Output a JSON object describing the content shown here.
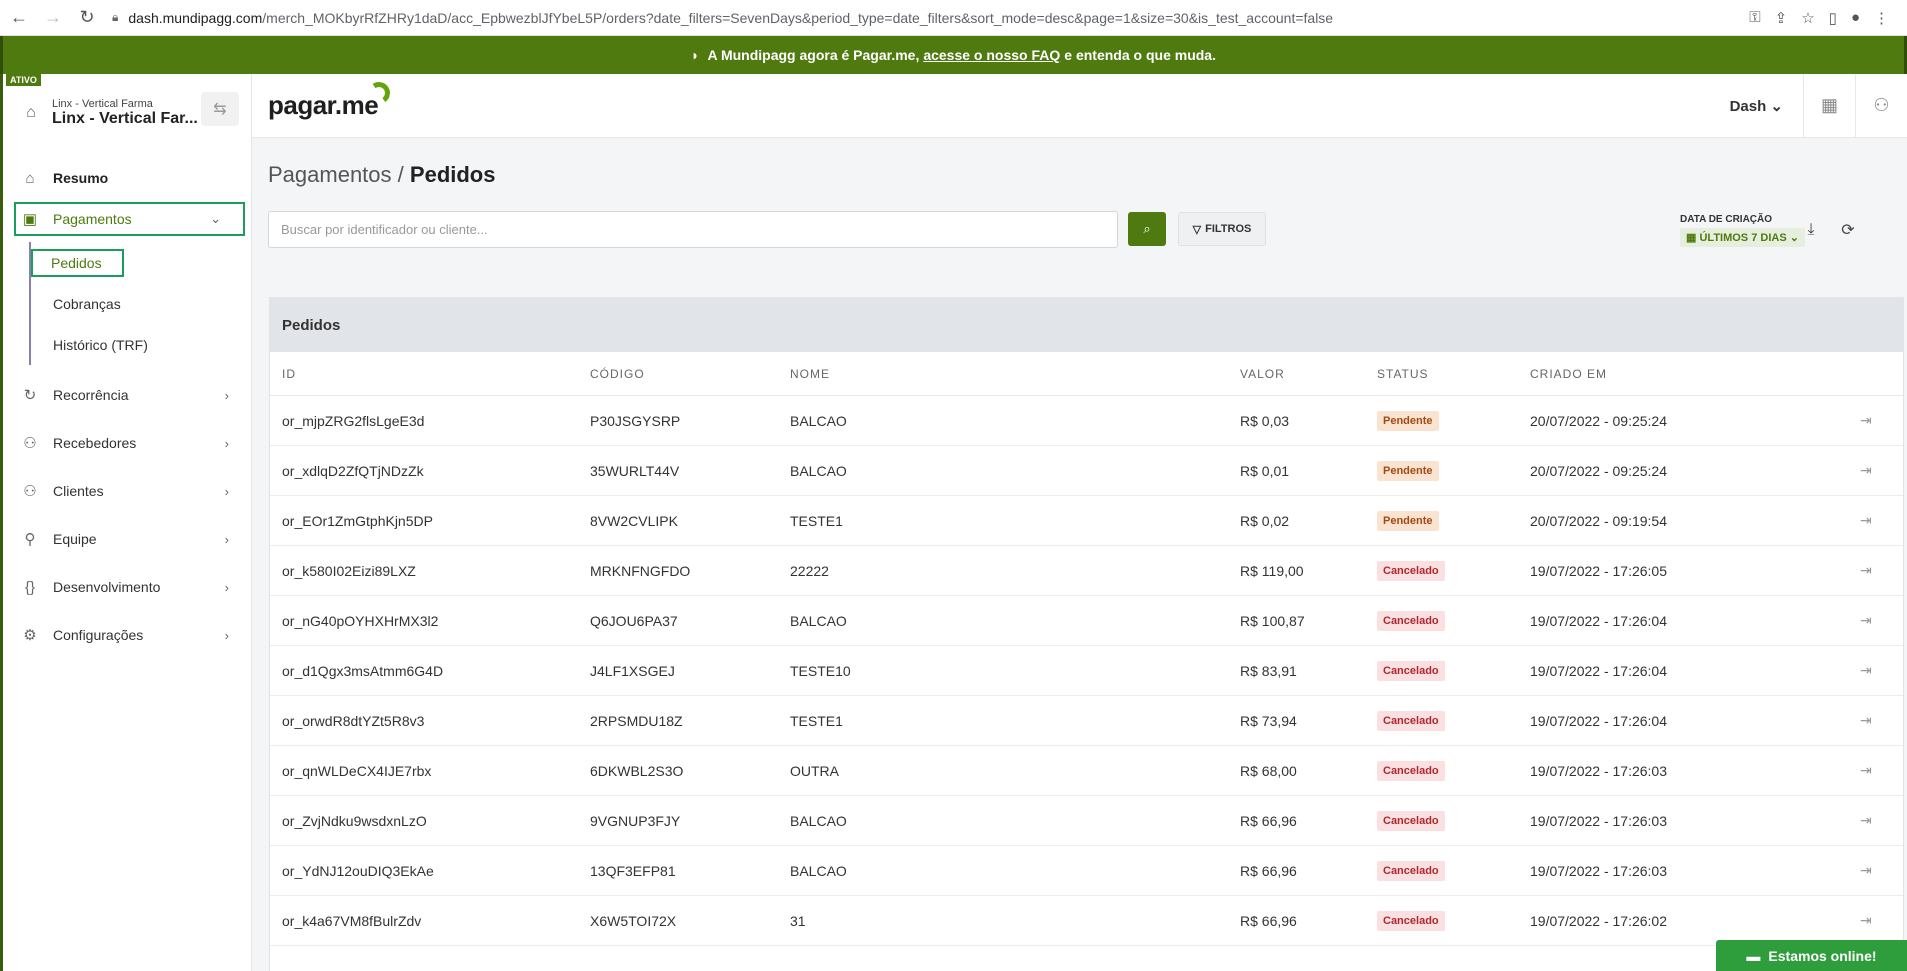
{
  "browser": {
    "url_host": "dash.mundipagg.com",
    "url_path": "/merch_MOKbyrRfZHRy1daD/acc_EpbwezblJfYbeL5P/orders?date_filters=SevenDays&period_type=date_filters&sort_mode=desc&page=1&size=30&is_test_account=false"
  },
  "banner": {
    "text_before": "A Mundipagg agora é Pagar.me,",
    "link": "acesse o nosso FAQ",
    "text_after": "e entenda o que muda."
  },
  "account": {
    "badge": "ATIVO",
    "sub": "Linx - Vertical Farma",
    "name": "Linx - Vertical Far..."
  },
  "sidebar": {
    "resumo": "Resumo",
    "pagamentos": "Pagamentos",
    "sub": [
      "Pedidos",
      "Cobranças",
      "Histórico (TRF)"
    ],
    "items": [
      "Recorrência",
      "Recebedores",
      "Clientes",
      "Equipe",
      "Desenvolvimento",
      "Configurações"
    ]
  },
  "header": {
    "logo": "pagar.me",
    "dash": "Dash"
  },
  "main": {
    "crumb_parent": "Pagamentos",
    "crumb_sep": "/",
    "crumb_current": "Pedidos",
    "search_placeholder": "Buscar por identificador ou cliente...",
    "filters": "FILTROS",
    "date_label": "DATA DE CRIAÇÃO",
    "date_value": "ÚLTIMOS 7 DIAS"
  },
  "table": {
    "title": "Pedidos",
    "headers": [
      "ID",
      "CÓDIGO",
      "NOME",
      "VALOR",
      "STATUS",
      "CRIADO EM"
    ],
    "rows": [
      [
        "or_mjpZRG2flsLgeE3d",
        "P30JSGYSRP",
        "BALCAO",
        "R$ 0,03",
        "Pendente",
        "20/07/2022 - 09:25:24"
      ],
      [
        "or_xdlqD2ZfQTjNDzZk",
        "35WURLT44V",
        "BALCAO",
        "R$ 0,01",
        "Pendente",
        "20/07/2022 - 09:25:24"
      ],
      [
        "or_EOr1ZmGtphKjn5DP",
        "8VW2CVLIPK",
        "TESTE1",
        "R$ 0,02",
        "Pendente",
        "20/07/2022 - 09:19:54"
      ],
      [
        "or_k580I02Eizi89LXZ",
        "MRKNFNGFDO",
        "22222",
        "R$ 119,00",
        "Cancelado",
        "19/07/2022 - 17:26:05"
      ],
      [
        "or_nG40pOYHXHrMX3l2",
        "Q6JOU6PA37",
        "BALCAO",
        "R$ 100,87",
        "Cancelado",
        "19/07/2022 - 17:26:04"
      ],
      [
        "or_d1Qgx3msAtmm6G4D",
        "J4LF1XSGEJ",
        "TESTE10",
        "R$ 83,91",
        "Cancelado",
        "19/07/2022 - 17:26:04"
      ],
      [
        "or_orwdR8dtYZt5R8v3",
        "2RPSMDU18Z",
        "TESTE1",
        "R$ 73,94",
        "Cancelado",
        "19/07/2022 - 17:26:04"
      ],
      [
        "or_qnWLDeCX4IJE7rbx",
        "6DKWBL2S3O",
        "OUTRA",
        "R$ 68,00",
        "Cancelado",
        "19/07/2022 - 17:26:03"
      ],
      [
        "or_ZvjNdku9wsdxnLzO",
        "9VGNUP3FJY",
        "BALCAO",
        "R$ 66,96",
        "Cancelado",
        "19/07/2022 - 17:26:03"
      ],
      [
        "or_YdNJ12ouDIQ3EkAe",
        "13QF3EFP81",
        "BALCAO",
        "R$ 66,96",
        "Cancelado",
        "19/07/2022 - 17:26:03"
      ],
      [
        "or_k4a67VM8fBulrZdv",
        "X6W5TOI72X",
        "31",
        "R$ 66,96",
        "Cancelado",
        "19/07/2022 - 17:26:02"
      ]
    ]
  },
  "chat": "Estamos online!",
  "colors": {
    "brand_green": "#4e7a10",
    "pending_bg": "#fbe3d2",
    "cancel_bg": "#fbe0e2"
  }
}
